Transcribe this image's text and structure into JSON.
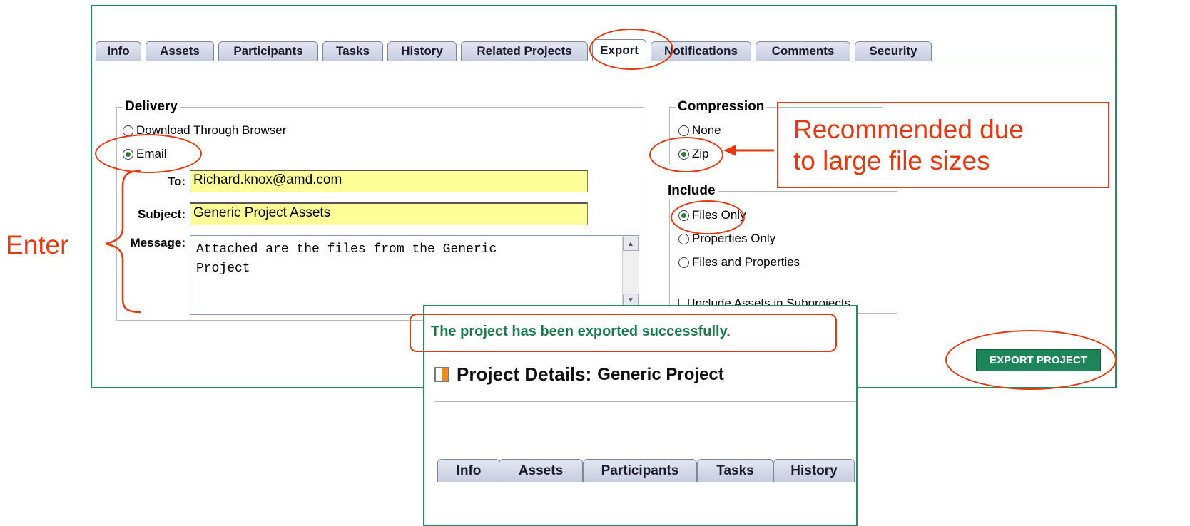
{
  "tabs": [
    "Info",
    "Assets",
    "Participants",
    "Tasks",
    "History",
    "Related Projects",
    "Export",
    "Notifications",
    "Comments",
    "Security"
  ],
  "active_tab": "Export",
  "delivery": {
    "legend": "Delivery",
    "option_browser": "Download Through Browser",
    "option_email": "Email",
    "to_label": "To:",
    "to_value": "Richard.knox@amd.com",
    "subject_label": "Subject:",
    "subject_value": "Generic Project Assets",
    "message_label": "Message:",
    "message_value": "Attached are the files from the Generic\nProject"
  },
  "compression": {
    "legend": "Compression",
    "option_none": "None",
    "option_zip": "Zip"
  },
  "include": {
    "legend": "Include",
    "option_files": "Files Only",
    "option_properties": "Properties Only",
    "option_both": "Files and Properties",
    "subprojects": "Include Assets in Subprojects"
  },
  "export_button": "EXPORT PROJECT",
  "popup": {
    "success_message": "The project has been exported successfully.",
    "title_prefix": "Project Details:",
    "title_project": "Generic Project",
    "tabs": [
      "Info",
      "Assets",
      "Participants",
      "Tasks",
      "History"
    ]
  },
  "annotations": {
    "enter": "Enter",
    "recommended": "Recommended due\nto large file sizes"
  },
  "colors": {
    "accent_green": "#1d8559",
    "annotation_red": "#e23a12",
    "field_yellow": "#ffff99"
  }
}
